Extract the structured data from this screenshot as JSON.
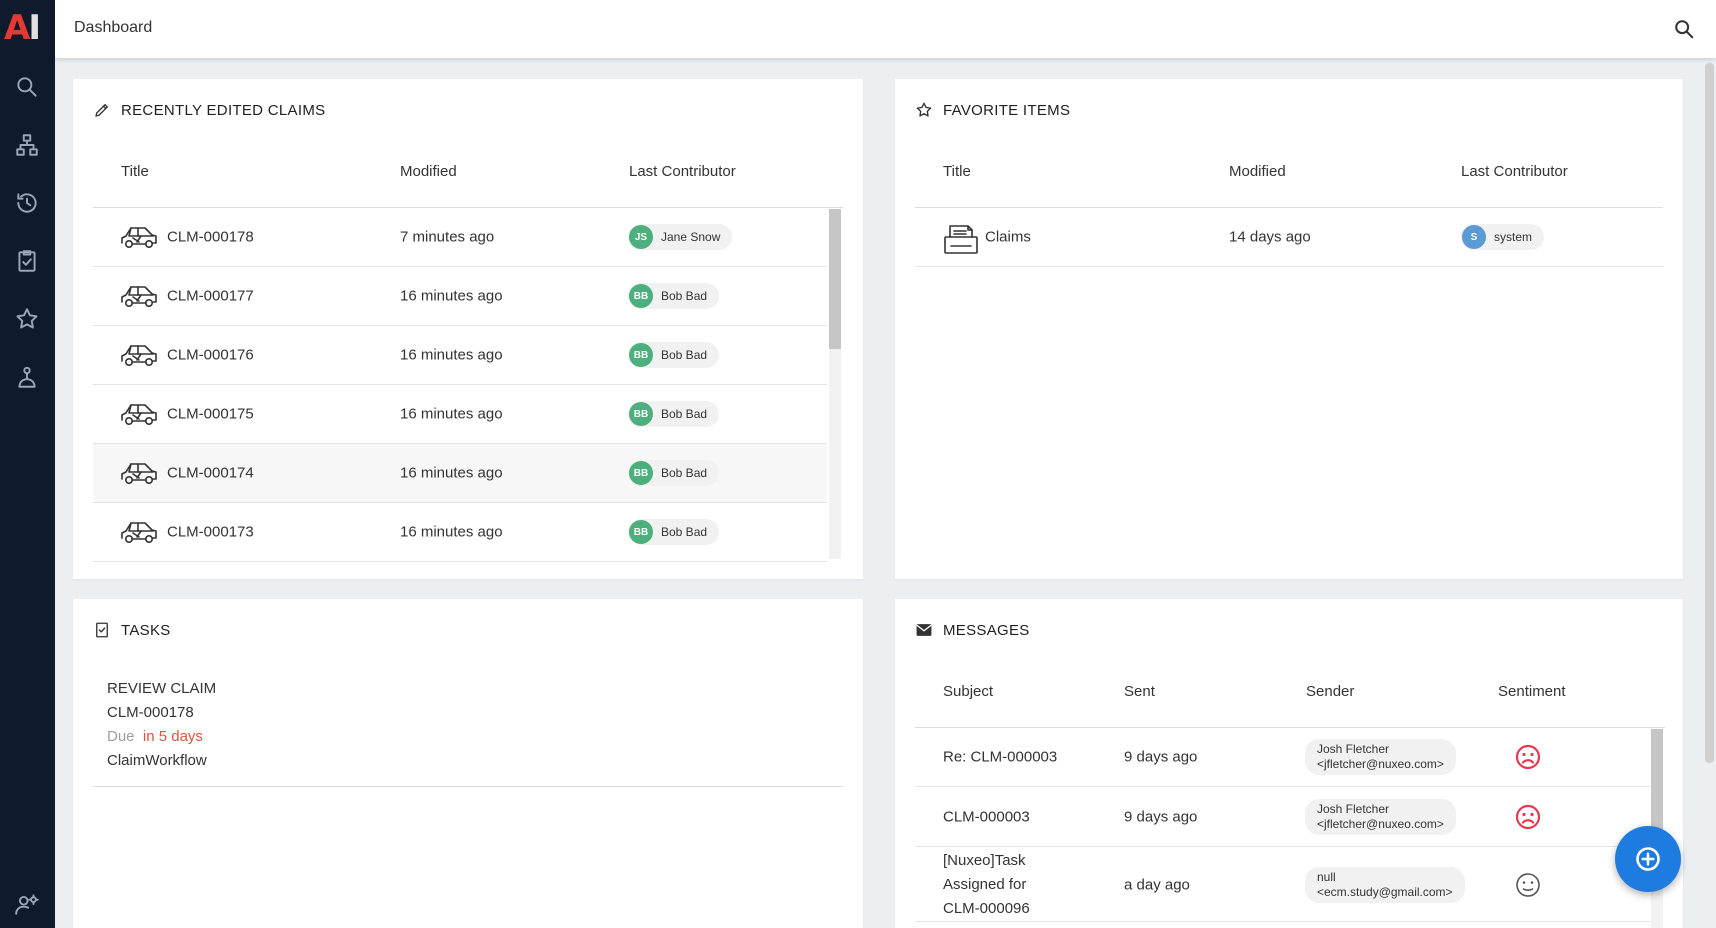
{
  "header": {
    "title": "Dashboard"
  },
  "sidebar": {
    "logo_a": "A",
    "logo_i": "I",
    "items": [
      "search-icon",
      "hierarchy-icon",
      "history-icon",
      "tasks-icon",
      "star-icon",
      "user-icon"
    ],
    "bottom": "user-settings-icon"
  },
  "recent_claims": {
    "title": "RECENTLY EDITED CLAIMS",
    "columns": {
      "title": "Title",
      "modified": "Modified",
      "contributor": "Last Contributor"
    },
    "rows": [
      {
        "title": "CLM-000178",
        "modified": "7 minutes ago",
        "initials": "JS",
        "contributor": "Jane Snow"
      },
      {
        "title": "CLM-000177",
        "modified": "16 minutes ago",
        "initials": "BB",
        "contributor": "Bob Bad"
      },
      {
        "title": "CLM-000176",
        "modified": "16 minutes ago",
        "initials": "BB",
        "contributor": "Bob Bad"
      },
      {
        "title": "CLM-000175",
        "modified": "16 minutes ago",
        "initials": "BB",
        "contributor": "Bob Bad"
      },
      {
        "title": "CLM-000174",
        "modified": "16 minutes ago",
        "initials": "BB",
        "contributor": "Bob Bad"
      },
      {
        "title": "CLM-000173",
        "modified": "16 minutes ago",
        "initials": "BB",
        "contributor": "Bob Bad"
      }
    ]
  },
  "favorites": {
    "title": "FAVORITE ITEMS",
    "columns": {
      "title": "Title",
      "modified": "Modified",
      "contributor": "Last Contributor"
    },
    "rows": [
      {
        "title": "Claims",
        "modified": "14 days ago",
        "initials": "S",
        "contributor": "system"
      }
    ]
  },
  "tasks": {
    "title": "TASKS",
    "item": {
      "name": "REVIEW CLAIM",
      "target": "CLM-000178",
      "due_label": "Due",
      "due_value": "in 5 days",
      "workflow": "ClaimWorkflow"
    }
  },
  "messages": {
    "title": "MESSAGES",
    "columns": {
      "subject": "Subject",
      "sent": "Sent",
      "sender": "Sender",
      "sentiment": "Sentiment"
    },
    "rows": [
      {
        "subject": "Re: CLM-000003",
        "sent": "9 days ago",
        "sender_name": "Josh Fletcher",
        "sender_email": "<jfletcher@nuxeo.com>",
        "sentiment": "negative"
      },
      {
        "subject": "CLM-000003",
        "sent": "9 days ago",
        "sender_name": "Josh Fletcher",
        "sender_email": "<jfletcher@nuxeo.com>",
        "sentiment": "negative"
      },
      {
        "subject_l1": "[Nuxeo]Task",
        "subject_l2": "Assigned for",
        "subject_l3": "CLM-000096",
        "sent": "a day ago",
        "sender_name": "null",
        "sender_email": "<ecm.study@gmail.com>",
        "sentiment": "neutral"
      }
    ]
  },
  "colors": {
    "sidebar": "#0f1a2c",
    "accent": "#1e7be0",
    "avatar_green": "#4caf7d",
    "avatar_blue": "#5b9bd5",
    "due": "#e0533c",
    "negative": "#e53950"
  }
}
